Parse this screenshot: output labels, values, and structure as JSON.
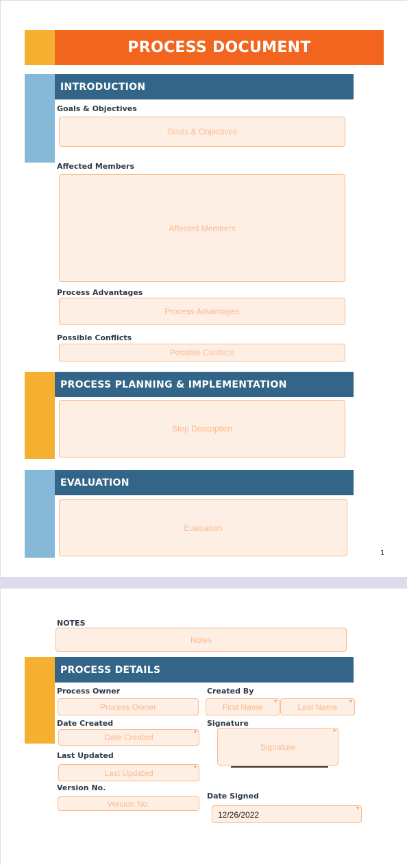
{
  "document": {
    "title": "PROCESS DOCUMENT",
    "page_number": "1",
    "colors": {
      "orange": "#f2651e",
      "yellow": "#f5b031",
      "light_blue": "#86b9d8",
      "navy": "#336588",
      "field_bg": "#feefe5",
      "field_border": "#fbb98a"
    }
  },
  "introduction": {
    "heading": "INTRODUCTION",
    "goals": {
      "label": "Goals & Objectives",
      "placeholder": "Goals & Objectives"
    },
    "affected": {
      "label": "Affected Members",
      "placeholder": "Affected Members"
    },
    "advantages": {
      "label": "Process Advantages",
      "placeholder": "Process Advantages"
    },
    "conflicts": {
      "label": "Possible Conflicts",
      "placeholder": "Possible Conflicts"
    }
  },
  "planning": {
    "heading": "PROCESS PLANNING & IMPLEMENTATION",
    "step": {
      "placeholder": "Step Description"
    }
  },
  "evaluation": {
    "heading": "EVALUATION",
    "field": {
      "placeholder": "Evaluation"
    }
  },
  "notes": {
    "label": "NOTES",
    "placeholder": "Notes"
  },
  "details": {
    "heading": "PROCESS DETAILS",
    "owner": {
      "label": "Process Owner",
      "placeholder": "Process Owner"
    },
    "created_by": {
      "label": "Created By",
      "first_placeholder": "First Name",
      "last_placeholder": "Last Name"
    },
    "date_created": {
      "label": "Date Created",
      "placeholder": "Date Created"
    },
    "signature": {
      "label": "Signature",
      "placeholder": "Signature"
    },
    "last_updated": {
      "label": "Last Updated",
      "placeholder": "Last Updated"
    },
    "version": {
      "label": "Version No.",
      "placeholder": "Version No."
    },
    "date_signed": {
      "label": "Date Signed",
      "value": "12/26/2022"
    },
    "required_mark": "*"
  }
}
